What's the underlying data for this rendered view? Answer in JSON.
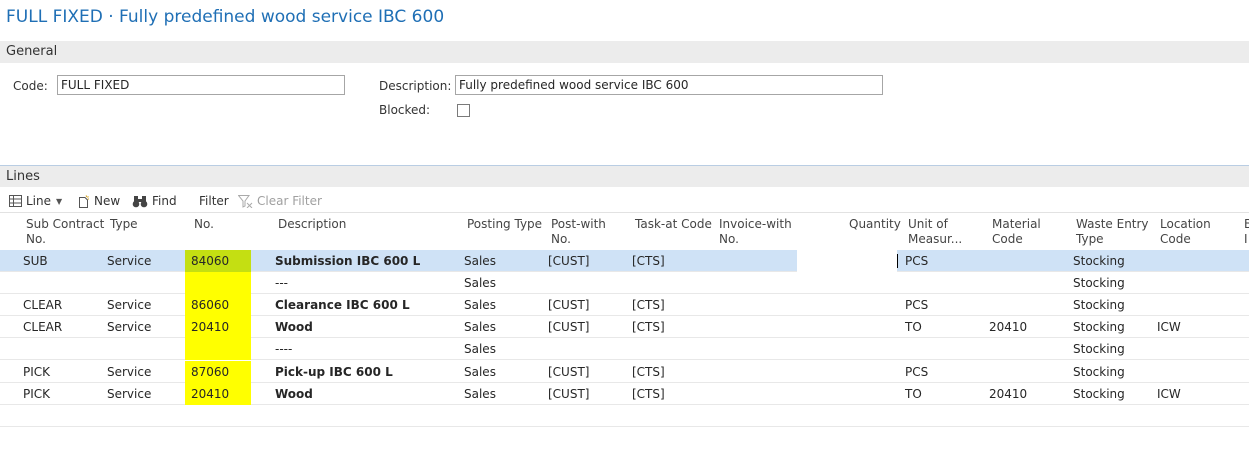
{
  "page": {
    "title": "FULL FIXED · Fully predefined wood service IBC 600"
  },
  "general": {
    "section_title": "General",
    "code_label": "Code:",
    "code_value": "FULL FIXED",
    "description_label": "Description:",
    "description_value": "Fully predefined wood service IBC 600",
    "blocked_label": "Blocked:",
    "blocked": false
  },
  "lines": {
    "section_title": "Lines",
    "toolbar": {
      "line": "Line",
      "new": "New",
      "find": "Find",
      "filter": "Filter",
      "clear_filter": "Clear Filter"
    },
    "headers": {
      "sub_contract_no_1": "Sub Contract",
      "sub_contract_no_2": "No.",
      "type": "Type",
      "no": "No.",
      "description": "Description",
      "posting_type": "Posting Type",
      "post_with_1": "Post-with",
      "post_with_2": "No.",
      "task_at_code": "Task-at Code",
      "invoice_with_1": "Invoice-with",
      "invoice_with_2": "No.",
      "quantity": "Quantity",
      "unit_1": "Unit of",
      "unit_2": "Measur...",
      "material_1": "Material",
      "material_2": "Code",
      "waste_1": "Waste Entry",
      "waste_2": "Type",
      "location_1": "Location",
      "location_2": "Code",
      "extra_1": "B",
      "extra_2": "I"
    },
    "rows": [
      {
        "sub": "SUB",
        "type": "Service",
        "no": "84060",
        "desc": "Submission IBC 600 L",
        "posting": "Sales",
        "post_with": "[CUST]",
        "task": "[CTS]",
        "unit": "PCS",
        "material": "",
        "waste": "Stocking",
        "location": ""
      },
      {
        "sub": "",
        "type": "",
        "no": "",
        "desc": "---",
        "posting": "Sales",
        "post_with": "",
        "task": "",
        "unit": "",
        "material": "",
        "waste": "Stocking",
        "location": ""
      },
      {
        "sub": "CLEAR",
        "type": "Service",
        "no": "86060",
        "desc": "Clearance IBC 600 L",
        "posting": "Sales",
        "post_with": "[CUST]",
        "task": "[CTS]",
        "unit": "PCS",
        "material": "",
        "waste": "Stocking",
        "location": ""
      },
      {
        "sub": "CLEAR",
        "type": "Service",
        "no": "20410",
        "desc": "Wood",
        "posting": "Sales",
        "post_with": "[CUST]",
        "task": "[CTS]",
        "unit": "TO",
        "material": "20410",
        "waste": "Stocking",
        "location": "ICW"
      },
      {
        "sub": "",
        "type": "",
        "no": "",
        "desc": "----",
        "posting": "Sales",
        "post_with": "",
        "task": "",
        "unit": "",
        "material": "",
        "waste": "Stocking",
        "location": ""
      },
      {
        "sub": "PICK",
        "type": "Service",
        "no": "87060",
        "desc": "Pick-up IBC 600 L",
        "posting": "Sales",
        "post_with": "[CUST]",
        "task": "[CTS]",
        "unit": "PCS",
        "material": "",
        "waste": "Stocking",
        "location": ""
      },
      {
        "sub": "PICK",
        "type": "Service",
        "no": "20410",
        "desc": "Wood",
        "posting": "Sales",
        "post_with": "[CUST]",
        "task": "[CTS]",
        "unit": "TO",
        "material": "20410",
        "waste": "Stocking",
        "location": "ICW"
      }
    ]
  },
  "colors": {
    "title": "#1f6fb5",
    "highlight": "#ffff00",
    "selected_row": "#cfe2f6"
  }
}
